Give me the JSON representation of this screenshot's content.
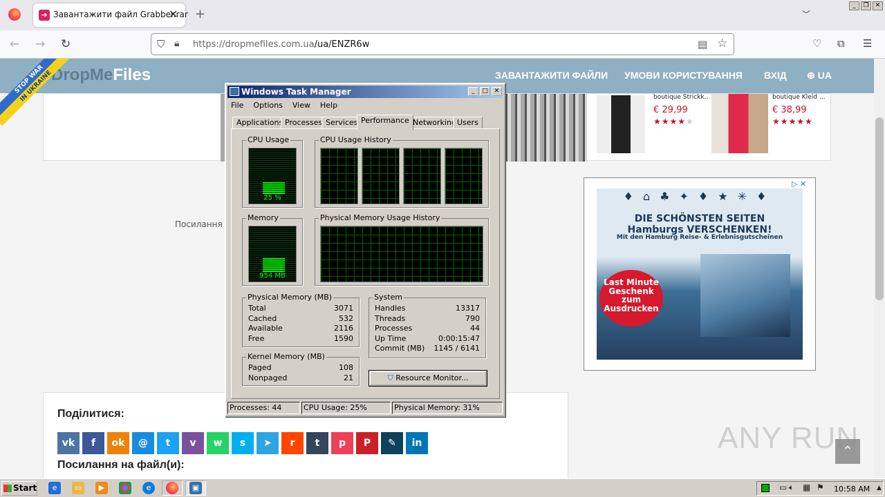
{
  "browser": {
    "tab_title": "Завантажити файл Grabber.rar",
    "url_host": "https://dropmefiles.com.ua",
    "url_path": "/ua/ENZR6w"
  },
  "site": {
    "logo_a": "DropMe",
    "logo_b": "Files",
    "ribbon_line1": "STOP WAR",
    "ribbon_line2": "IN UKRAINE",
    "menu": [
      "ЗАВАНТАЖИТИ ФАЙЛИ",
      "УМОВИ КОРИСТУВАННЯ",
      "ВХІД",
      "UA"
    ],
    "products": [
      {
        "title": "boutique Strickk…",
        "price": "€ 29,99",
        "stars": "★★★★★",
        "rating": 4
      },
      {
        "title": "boutique Kleid …",
        "price": "€ 38,99",
        "stars": "★★★★★",
        "rating": 5
      }
    ],
    "link_label": "Посилання ,",
    "share_title": "Поділитися:",
    "links_title": "Посилання на файл(и):",
    "share_icons": [
      {
        "name": "vk-icon",
        "glyph": "vk",
        "color": "#4c75a3"
      },
      {
        "name": "facebook-icon",
        "glyph": "f",
        "color": "#3b5998"
      },
      {
        "name": "odnoklassniki-icon",
        "glyph": "ok",
        "color": "#ee8208"
      },
      {
        "name": "moimir-icon",
        "glyph": "@",
        "color": "#168de2"
      },
      {
        "name": "twitter-icon",
        "glyph": "t",
        "color": "#1da1f2"
      },
      {
        "name": "viber-icon",
        "glyph": "v",
        "color": "#7b519d"
      },
      {
        "name": "whatsapp-icon",
        "glyph": "w",
        "color": "#25d366"
      },
      {
        "name": "skype-icon",
        "glyph": "s",
        "color": "#00aff0"
      },
      {
        "name": "telegram-icon",
        "glyph": "➤",
        "color": "#2ca5e0"
      },
      {
        "name": "reddit-icon",
        "glyph": "r",
        "color": "#ff4500"
      },
      {
        "name": "tumblr-icon",
        "glyph": "t",
        "color": "#35465c"
      },
      {
        "name": "pocket-icon",
        "glyph": "p",
        "color": "#ef4056"
      },
      {
        "name": "pinterest-icon",
        "glyph": "P",
        "color": "#cb2027"
      },
      {
        "name": "livejournal-icon",
        "glyph": "✎",
        "color": "#0d425a"
      },
      {
        "name": "linkedin-icon",
        "glyph": "in",
        "color": "#0077b5"
      }
    ]
  },
  "ad": {
    "headline": "DIE SCHÖNSTEN SEITEN",
    "headline2": "Hamburgs VERSCHENKEN!",
    "sub": "Mit den Hamburg Reise- & Erlebnisgutscheinen",
    "badge": "Last Minute Geschenk zum Ausdrucken"
  },
  "taskmgr": {
    "title": "Windows Task Manager",
    "menu": [
      "File",
      "Options",
      "View",
      "Help"
    ],
    "tabs": [
      "Applications",
      "Processes",
      "Services",
      "Performance",
      "Networking",
      "Users"
    ],
    "active_tab": "Performance",
    "cpu_label": "CPU Usage",
    "cpu_value": "25 %",
    "cpu_fraction": 0.25,
    "cpu_hist_label": "CPU Usage History",
    "mem_label": "Memory",
    "mem_value": "954 MB",
    "mem_fraction": 0.31,
    "mem_hist_label": "Physical Memory Usage History",
    "phys_title": "Physical Memory (MB)",
    "phys": [
      [
        "Total",
        "3071"
      ],
      [
        "Cached",
        "532"
      ],
      [
        "Available",
        "2116"
      ],
      [
        "Free",
        "1590"
      ]
    ],
    "kernel_title": "Kernel Memory (MB)",
    "kernel": [
      [
        "Paged",
        "108"
      ],
      [
        "Nonpaged",
        "21"
      ]
    ],
    "system_title": "System",
    "system": [
      [
        "Handles",
        "13317"
      ],
      [
        "Threads",
        "790"
      ],
      [
        "Processes",
        "44"
      ],
      [
        "Up Time",
        "0:00:15:47"
      ],
      [
        "Commit (MB)",
        "1145 / 6141"
      ]
    ],
    "resmon_button": "Resource Monitor...",
    "status": [
      "Processes: 44",
      "CPU Usage: 25%",
      "Physical Memory: 31%"
    ]
  },
  "taskbar": {
    "start": "Start",
    "clock": "10:58 AM"
  },
  "watermark": "ANY RUN"
}
